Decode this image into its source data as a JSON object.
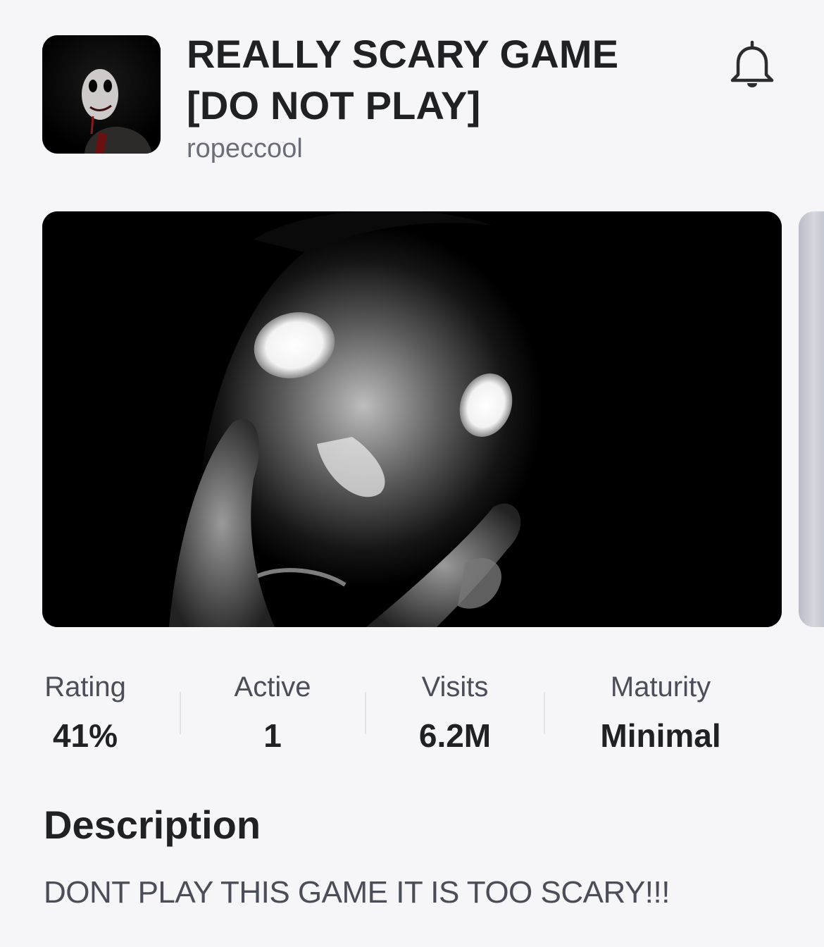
{
  "game": {
    "title": "REALLY SCARY GAME [DO NOT PLAY]",
    "creator": "ropeccool",
    "icon": "game-icon-thumbnail",
    "notify_icon": "bell-icon"
  },
  "stats": [
    {
      "label": "Rating",
      "value": "41%"
    },
    {
      "label": "Active",
      "value": "1"
    },
    {
      "label": "Visits",
      "value": "6.2M"
    },
    {
      "label": "Maturity",
      "value": "Minimal"
    }
  ],
  "description": {
    "heading": "Description",
    "text": "DONT PLAY THIS GAME IT IS TOO SCARY!!!"
  }
}
